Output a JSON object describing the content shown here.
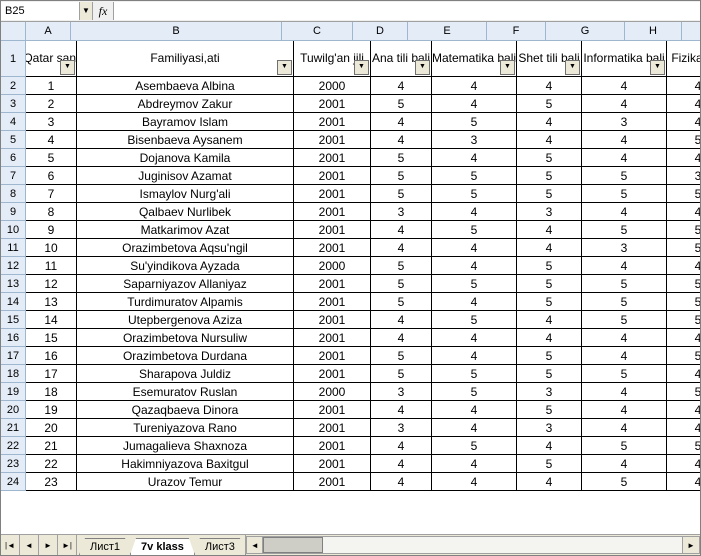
{
  "formula_bar": {
    "namebox": "B25",
    "fx": "fx",
    "formula": ""
  },
  "columns": [
    {
      "letter": "A",
      "cls": "cA",
      "header": "Qatar sani"
    },
    {
      "letter": "B",
      "cls": "cB",
      "header": "Familiyasi,ati"
    },
    {
      "letter": "C",
      "cls": "cC",
      "header": "Tuwilg'an jili"
    },
    {
      "letter": "D",
      "cls": "cD",
      "header": "Ana tili bali"
    },
    {
      "letter": "E",
      "cls": "cE",
      "header": "Matematika bali"
    },
    {
      "letter": "F",
      "cls": "cF",
      "header": "Shet tili bali"
    },
    {
      "letter": "G",
      "cls": "cG",
      "header": "Informatika bali"
    },
    {
      "letter": "H",
      "cls": "cH",
      "header": "Fizika bali"
    }
  ],
  "rows": [
    {
      "n": 1,
      "a": "1",
      "b": "Asembaeva Albina",
      "c": "2000",
      "d": "4",
      "e": "4",
      "f": "4",
      "g": "4",
      "h": "4"
    },
    {
      "n": 2,
      "a": "2",
      "b": "Abdreymov Zakur",
      "c": "2001",
      "d": "5",
      "e": "4",
      "f": "5",
      "g": "4",
      "h": "4"
    },
    {
      "n": 3,
      "a": "3",
      "b": "Bayramov Islam",
      "c": "2001",
      "d": "4",
      "e": "5",
      "f": "4",
      "g": "3",
      "h": "4"
    },
    {
      "n": 4,
      "a": "4",
      "b": "Bisenbaeva Aysanem",
      "c": "2001",
      "d": "4",
      "e": "3",
      "f": "4",
      "g": "4",
      "h": "5"
    },
    {
      "n": 5,
      "a": "5",
      "b": "Dojanova Kamila",
      "c": "2001",
      "d": "5",
      "e": "4",
      "f": "5",
      "g": "4",
      "h": "4"
    },
    {
      "n": 6,
      "a": "6",
      "b": "Juginisov Azamat",
      "c": "2001",
      "d": "5",
      "e": "5",
      "f": "5",
      "g": "5",
      "h": "3"
    },
    {
      "n": 7,
      "a": "7",
      "b": "Ismaylov Nurg'ali",
      "c": "2001",
      "d": "5",
      "e": "5",
      "f": "5",
      "g": "5",
      "h": "5"
    },
    {
      "n": 8,
      "a": "8",
      "b": "Qalbaev Nurlibek",
      "c": "2001",
      "d": "3",
      "e": "4",
      "f": "3",
      "g": "4",
      "h": "4"
    },
    {
      "n": 9,
      "a": "9",
      "b": "Matkarimov Azat",
      "c": "2001",
      "d": "4",
      "e": "5",
      "f": "4",
      "g": "5",
      "h": "5"
    },
    {
      "n": 10,
      "a": "10",
      "b": "Orazimbetova Aqsu'ngil",
      "c": "2001",
      "d": "4",
      "e": "4",
      "f": "4",
      "g": "3",
      "h": "5"
    },
    {
      "n": 11,
      "a": "11",
      "b": "Su'yindikova Ayzada",
      "c": "2000",
      "d": "5",
      "e": "4",
      "f": "5",
      "g": "4",
      "h": "4"
    },
    {
      "n": 12,
      "a": "12",
      "b": "Saparniyazov Allaniyaz",
      "c": "2001",
      "d": "5",
      "e": "5",
      "f": "5",
      "g": "5",
      "h": "5"
    },
    {
      "n": 13,
      "a": "13",
      "b": "Turdimuratov Alpamis",
      "c": "2001",
      "d": "5",
      "e": "4",
      "f": "5",
      "g": "5",
      "h": "5"
    },
    {
      "n": 14,
      "a": "14",
      "b": "Utepbergenova Aziza",
      "c": "2001",
      "d": "4",
      "e": "5",
      "f": "4",
      "g": "5",
      "h": "5"
    },
    {
      "n": 15,
      "a": "15",
      "b": "Orazimbetova Nursuliw",
      "c": "2001",
      "d": "4",
      "e": "4",
      "f": "4",
      "g": "4",
      "h": "4"
    },
    {
      "n": 16,
      "a": "16",
      "b": "Orazimbetova Durdana",
      "c": "2001",
      "d": "5",
      "e": "4",
      "f": "5",
      "g": "4",
      "h": "5"
    },
    {
      "n": 17,
      "a": "17",
      "b": "Sharapova Juldiz",
      "c": "2001",
      "d": "5",
      "e": "5",
      "f": "5",
      "g": "5",
      "h": "4"
    },
    {
      "n": 18,
      "a": "18",
      "b": "Esemuratov Ruslan",
      "c": "2000",
      "d": "3",
      "e": "5",
      "f": "3",
      "g": "4",
      "h": "5"
    },
    {
      "n": 19,
      "a": "19",
      "b": "Qazaqbaeva Dinora",
      "c": "2001",
      "d": "4",
      "e": "4",
      "f": "5",
      "g": "4",
      "h": "4"
    },
    {
      "n": 20,
      "a": "20",
      "b": "Tureniyazova Rano",
      "c": "2001",
      "d": "3",
      "e": "4",
      "f": "3",
      "g": "4",
      "h": "4"
    },
    {
      "n": 21,
      "a": "21",
      "b": "Jumagalieva Shaxnoza",
      "c": "2001",
      "d": "4",
      "e": "5",
      "f": "4",
      "g": "5",
      "h": "5"
    },
    {
      "n": 22,
      "a": "22",
      "b": "Hakimniyazova Baxitgul",
      "c": "2001",
      "d": "4",
      "e": "4",
      "f": "5",
      "g": "4",
      "h": "4"
    },
    {
      "n": 23,
      "a": "23",
      "b": "Urazov Temur",
      "c": "2001",
      "d": "4",
      "e": "4",
      "f": "4",
      "g": "5",
      "h": "4"
    }
  ],
  "sheets": [
    {
      "name": "Лист1",
      "active": false
    },
    {
      "name": "7v klass",
      "active": true
    },
    {
      "name": "Лист3",
      "active": false
    }
  ],
  "nav": {
    "first": "|◄",
    "prev": "◄",
    "next": "►",
    "last": "►|"
  }
}
